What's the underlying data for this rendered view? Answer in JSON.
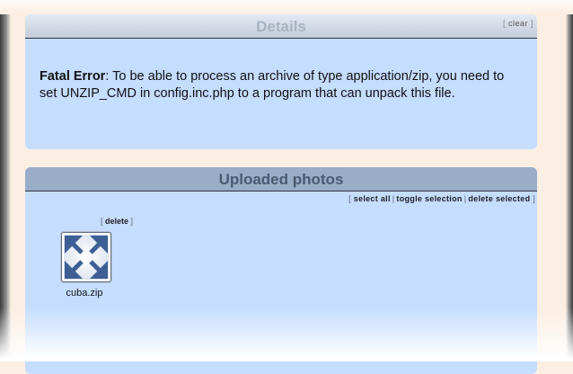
{
  "details": {
    "title": "Details",
    "clear_label": "clear",
    "error_label": "Fatal Error",
    "error_message": ": To be able to process an archive of type application/zip, you need to set UNZIP_CMD in config.inc.php to a program that can unpack this file."
  },
  "uploaded": {
    "title": "Uploaded photos",
    "actions": {
      "select_all": "select all",
      "toggle_selection": "toggle selection",
      "delete_selected": "delete selected"
    },
    "items": [
      {
        "name": "cuba.zip",
        "delete_label": "delete",
        "icon": "archive-arrows-icon"
      }
    ]
  },
  "colors": {
    "panel_bg": "#c5ddff",
    "header_bg": "#99adc8",
    "icon_blue": "#3d5f95"
  }
}
